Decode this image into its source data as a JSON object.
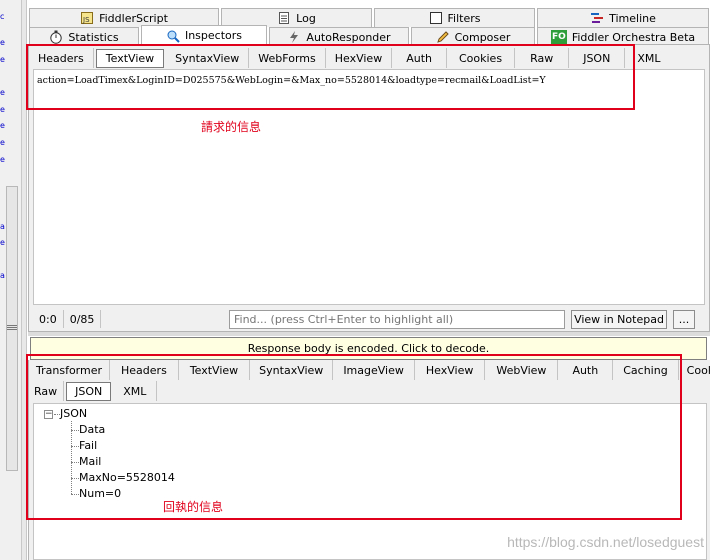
{
  "top_tabs_row1": [
    {
      "label": "FiddlerScript",
      "icon": "script-icon"
    },
    {
      "label": "Log",
      "icon": "log-icon"
    },
    {
      "label": "Filters",
      "icon": "checkbox-icon"
    },
    {
      "label": "Timeline",
      "icon": "timeline-icon"
    }
  ],
  "top_tabs_row2": [
    {
      "label": "Statistics",
      "icon": "stopwatch-icon"
    },
    {
      "label": "Inspectors",
      "icon": "inspect-icon"
    },
    {
      "label": "AutoResponder",
      "icon": "lightning-icon"
    },
    {
      "label": "Composer",
      "icon": "pencil-icon"
    },
    {
      "label": "Fiddler Orchestra Beta",
      "icon": "fo-icon",
      "icon_text": "FO"
    }
  ],
  "request": {
    "tabs": [
      "Headers",
      "TextView",
      "SyntaxView",
      "WebForms",
      "HexView",
      "Auth",
      "Cookies",
      "Raw",
      "JSON",
      "XML"
    ],
    "active_tab": "TextView",
    "body_text": "action=LoadTimex&LoginID=D025575&WebLogin=&Max_no=5528014&loadtype=recmail&LoadList=Y",
    "status_pos": "0:0",
    "status_count": "0/85",
    "find_placeholder": "Find... (press Ctrl+Enter to highlight all)",
    "view_in_notepad": "View in Notepad",
    "more_button": "...",
    "annotation": "請求的信息"
  },
  "response": {
    "encoded_notice": "Response body is encoded. Click to decode.",
    "tabs_row1": [
      "Transformer",
      "Headers",
      "TextView",
      "SyntaxView",
      "ImageView",
      "HexView",
      "WebView",
      "Auth",
      "Caching",
      "Cookies"
    ],
    "tabs_row2": [
      "Raw",
      "JSON",
      "XML"
    ],
    "active_tab": "JSON",
    "tree": {
      "expander": "−",
      "root": "JSON",
      "children": [
        "Data",
        "Fail",
        "Mail",
        "MaxNo=5528014",
        "Num=0"
      ]
    },
    "annotation": "回執的信息"
  },
  "watermark": "https://blog.csdn.net/losedguest",
  "colors": {
    "annotation_red": "#e0001b",
    "notice_bg": "#ffffe1",
    "window_bg": "#f0f0f0"
  }
}
